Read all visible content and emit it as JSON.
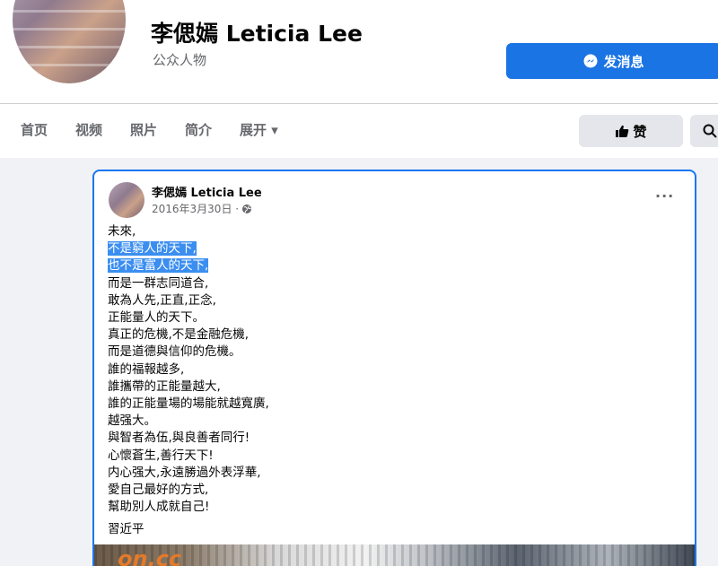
{
  "page": {
    "name": "李偲嫣 Leticia Lee",
    "category": "公众人物",
    "message_button": "发消息",
    "like_button": "赞"
  },
  "nav": {
    "tabs": [
      "首页",
      "视频",
      "照片",
      "简介",
      "展开 ▾"
    ]
  },
  "post": {
    "author": "李偲嫣 Leticia Lee",
    "date": "2016年3月30日 · ",
    "more": "···",
    "lines": [
      "未來,",
      "不是窮人的天下,",
      "也不是富人的天下,",
      "而是一群志同道合,",
      "敢為人先,正直,正念,",
      "正能量人的天下。",
      "真正的危機,不是金融危機,",
      "而是道德與信仰的危機。",
      "誰的福報越多,",
      "誰攜帶的正能量越大,",
      "誰的正能量場的場能就越寬廣,",
      "越强大。",
      "與智者為伍,與良善者同行!",
      "心懷蒼生,善行天下!",
      "内心强大,永遠勝過外表浮華,",
      "愛自己最好的方式,",
      "幫助別人成就自己!"
    ],
    "signature": "習近平",
    "image_watermark": "on.cc"
  },
  "colors": {
    "accent": "#1b74e4",
    "highlight": "#3b8ef0",
    "card_border": "#1877f2",
    "background": "#f0f2f5"
  },
  "icons": {
    "messenger": "messenger-icon",
    "like": "thumbs-up-icon",
    "search": "search-icon",
    "globe": "globe-icon"
  }
}
